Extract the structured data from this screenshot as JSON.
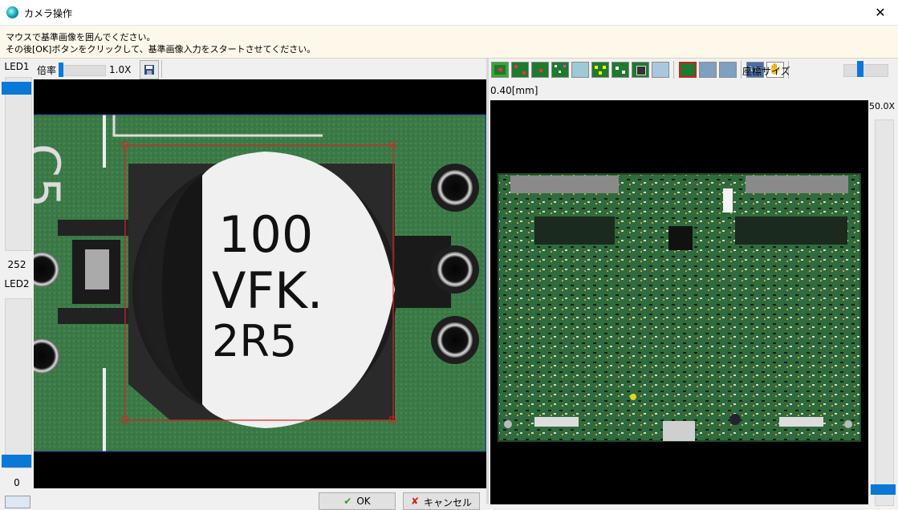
{
  "window": {
    "title": "カメラ操作",
    "close_icon": "close-icon"
  },
  "instruction": {
    "line1": "マウスで基準画像を囲んでください。",
    "line2": "その後[OK]ボタンをクリックして、基準画像入力をスタートさせてください。"
  },
  "led": {
    "led1_label": "LED1",
    "led1_value": "252",
    "led1_level": 1.0,
    "led2_label": "LED2",
    "led2_value": "0",
    "led2_level": 0.0
  },
  "left_toolbar": {
    "zoom_label": "倍率",
    "zoom_value": "1.0X",
    "save_icon": "save-icon"
  },
  "component_image": {
    "marking_line1": "100",
    "marking_line2": "VFK.",
    "marking_line3": "2R5"
  },
  "footer": {
    "ok_label": "OK",
    "cancel_label": "キャンセル"
  },
  "right_toolbar": {
    "coord_size_label": "座標サイズ",
    "tool_icons": [
      "board-red-icon",
      "board-points-icon",
      "board-dot-icon",
      "board-grid-icon",
      "board-light-icon",
      "board-yellow-icon",
      "board-green-icon",
      "board-chip-icon",
      "board-list-icon",
      "board-select-icon",
      "board-frame-icon",
      "board-frame2-icon",
      "zoom-100-icon",
      "hand-icon"
    ]
  },
  "right_view": {
    "scale_label": "0.40[mm]",
    "zoom_value": "50.0X"
  },
  "colors": {
    "accent": "#0a78d7",
    "selection": "#e02020",
    "pcb_green": "#2f6b3c"
  }
}
